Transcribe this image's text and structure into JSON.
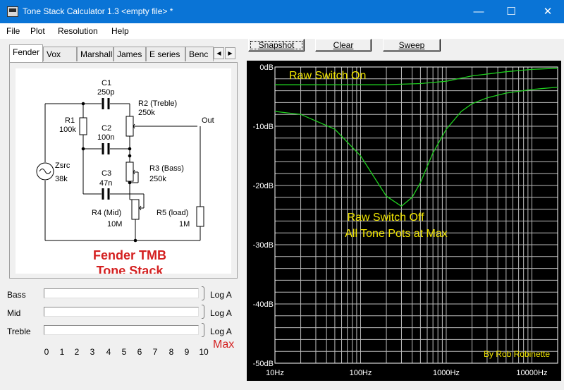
{
  "window": {
    "title": "Tone Stack Calculator 1.3 <empty file> *",
    "minimize_glyph": "—",
    "maximize_glyph": "☐",
    "close_glyph": "✕"
  },
  "menu": [
    "File",
    "Plot",
    "Resolution",
    "Help"
  ],
  "tabs": [
    "Fender",
    "Vox",
    "Marshall",
    "James",
    "E series",
    "Benc"
  ],
  "tab_scroll": {
    "left": "◀",
    "right": "▶"
  },
  "schematic": {
    "c1_name": "C1",
    "c1_value": "250p",
    "r2_name": "R2 (Treble)",
    "r2_value": "250k",
    "out": "Out",
    "r1_name": "R1",
    "r1_value": "100k",
    "c2_name": "C2",
    "c2_value": "100n",
    "zsrc_name": "Zsrc",
    "zsrc_value": "38k",
    "r3_name": "R3 (Bass)",
    "r3_value": "250k",
    "c3_name": "C3",
    "c3_value": "47n",
    "r4_name": "R4 (Mid)",
    "r4_value": "10M",
    "r5_name": "R5 (load)",
    "r5_value": "1M",
    "caption_line1": "Fender TMB",
    "caption_line2": "Tone Stack"
  },
  "controls": [
    {
      "name": "Bass",
      "taper": "Log A",
      "setting": 10
    },
    {
      "name": "Mid",
      "taper": "Log A",
      "setting": 10
    },
    {
      "name": "Treble",
      "taper": "Log A",
      "setting": 10
    }
  ],
  "scale": [
    "0",
    "1",
    "2",
    "3",
    "4",
    "5",
    "6",
    "7",
    "8",
    "9",
    "10"
  ],
  "scale_max": "Max",
  "buttons": {
    "snapshot": "Snapshot",
    "clear": "Clear",
    "sweep": "Sweep"
  },
  "colors": {
    "titlebar": "#0a74d6",
    "trace": "#1fcf1f",
    "annotation": "#f2e600",
    "caption": "#d42020",
    "plot_bg": "#000000"
  },
  "chart_data": {
    "type": "line",
    "x_scale": "log",
    "xlim": [
      10,
      20000
    ],
    "ylim": [
      -50,
      0
    ],
    "x_ticks": [
      "10Hz",
      "100Hz",
      "1000Hz",
      "10000Hz"
    ],
    "y_ticks": [
      "0dB",
      "-10dB",
      "-20dB",
      "-30dB",
      "-40dB",
      "-50dB"
    ],
    "grid": true,
    "annotations": [
      "Raw Switch On",
      "Raw Switch Off",
      "All Tone Pots at Max"
    ],
    "credit": "By Rob Robinette",
    "series": [
      {
        "x": [
          10,
          50,
          100,
          200,
          300,
          500,
          1000,
          2000,
          5000,
          10000,
          20000
        ],
        "y": [
          -3,
          -3,
          -3,
          -3,
          -2.9,
          -2.8,
          -2.4,
          -1.5,
          -0.8,
          -0.4,
          -0.2
        ]
      },
      {
        "x": [
          10,
          20,
          50,
          100,
          150,
          200,
          300,
          400,
          500,
          700,
          1000,
          1500,
          2000,
          3000,
          5000,
          10000,
          20000
        ],
        "y": [
          -7.5,
          -8,
          -10.5,
          -15,
          -19,
          -21.8,
          -23.5,
          -22,
          -19.5,
          -14.5,
          -10.5,
          -7.5,
          -6.2,
          -5.2,
          -4.4,
          -3.8,
          -3.4
        ]
      }
    ]
  }
}
